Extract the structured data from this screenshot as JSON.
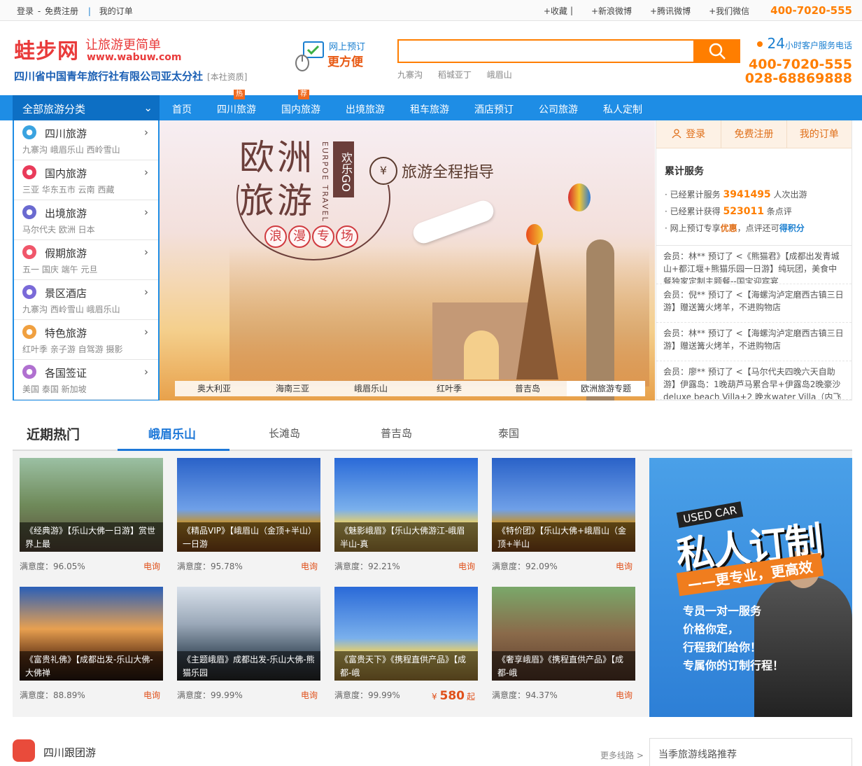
{
  "topbar": {
    "login": "登录",
    "sep": "-",
    "register": "免费注册",
    "divider": "|",
    "orders": "我的订单",
    "links": [
      "+收藏",
      "|",
      "+新浪微博",
      "+腾讯微博",
      "+我们微信"
    ],
    "phone": "400-7020-555"
  },
  "header": {
    "brand": "蛙步网",
    "slogan": "让旅游更简单",
    "url": "www.wabuw.com",
    "company": "四川省中国青年旅行社有限公司亚太分社",
    "company_tag": "[本社资质]",
    "online_line1": "网上预订",
    "online_line2": "更方便",
    "search_placeholder": "",
    "hotwords": [
      "九寨沟",
      "稻城亚丁",
      "峨眉山"
    ],
    "service_24": "24",
    "service_label": "小时客户服务电话",
    "phone1": "400-7020-555",
    "phone2": "028-68869888"
  },
  "nav": {
    "allcat": "全部旅游分类",
    "items": [
      {
        "label": "首页",
        "tag": ""
      },
      {
        "label": "四川旅游",
        "tag": "热"
      },
      {
        "label": "国内旅游",
        "tag": "荐"
      },
      {
        "label": "出境旅游",
        "tag": ""
      },
      {
        "label": "租车旅游",
        "tag": ""
      },
      {
        "label": "酒店预订",
        "tag": ""
      },
      {
        "label": "公司旅游",
        "tag": ""
      },
      {
        "label": "私人定制",
        "tag": ""
      }
    ]
  },
  "categories": [
    {
      "name": "四川旅游",
      "sub": "九寨沟  峨眉乐山  西岭雪山",
      "icon": "panda-icon",
      "color": "#3aa3e0"
    },
    {
      "name": "国内旅游",
      "sub": "三亚 华东五市 云南 西藏",
      "icon": "china-map-icon",
      "color": "#e93b5a"
    },
    {
      "name": "出境旅游",
      "sub": "马尔代夫 欧洲 日本",
      "icon": "globe-flower-icon",
      "color": "#6a6ad0"
    },
    {
      "name": "假期旅游",
      "sub": "五一  国庆  端午  元旦",
      "icon": "camera-icon",
      "color": "#f0566a"
    },
    {
      "name": "景区酒店",
      "sub": "九寨沟  西岭雪山  峨眉乐山",
      "icon": "hotel-icon",
      "color": "#7a6ad8"
    },
    {
      "name": "特色旅游",
      "sub": "红叶季  亲子游  自驾游  摄影",
      "icon": "tag-icon",
      "color": "#f0a040"
    },
    {
      "name": "各国签证",
      "sub": "美国 泰国 新加坡",
      "icon": "balloon-icon",
      "color": "#b070d0"
    }
  ],
  "banner": {
    "title_line1": "欧洲",
    "title_line2": "旅游",
    "vertical": "欢乐GO",
    "english": "EURPOE TRAVEL",
    "roman": [
      "浪",
      "漫",
      "专",
      "场"
    ],
    "guide_icon": "¥",
    "guide": "旅游全程指导",
    "tabs": [
      "奥大利亚",
      "海南三亚",
      "峨眉乐山",
      "红叶季",
      "普吉岛",
      "欧洲旅游专题"
    ]
  },
  "side": {
    "login": "登录",
    "register": "免费注册",
    "orders": "我的订单",
    "heading": "累计服务",
    "stat1_pre": "已经累计服务",
    "stat1_num": "3941495",
    "stat1_post": "人次出游",
    "stat2_pre": "已经累计获得",
    "stat2_num": "523011",
    "stat2_post": "条点评",
    "stat3_pre": "网上预订专享",
    "stat3_hl": "优惠",
    "stat3_mid": "，点评还可",
    "stat3_hl2": "得积分",
    "feeds": [
      "会员：林** 预订了 <《熊猫君》【成都出发青城山+都江堰+熊猫乐园一日游】纯玩团，美食中餐独家定制主题餐--国宝迎宾宴",
      "会员：倪** 预订了 <【海螺沟泸定磨西古镇三日游】赠送篝火烤羊，不进购物店",
      "会员：林** 预订了 <【海螺沟泸定磨西古镇三日游】赠送篝火烤羊，不进购物店",
      "会员：廖** 预订了 <【马尔代夫四晚六天自助游】伊露岛：1晚葫芦马累合早+伊露岛2晚豪沙deluxe beach Villa+2 晚水water Villa（内飞接"
    ]
  },
  "hot": {
    "title": "近期热门",
    "tabs": [
      "峨眉乐山",
      "长滩岛",
      "普吉岛",
      "泰国"
    ],
    "cards": [
      {
        "caption": "《经典游》【乐山大佛一日游】赏世界上最",
        "rating": "满意度：96.05%",
        "action": "电询",
        "price": ""
      },
      {
        "caption": "《精品VIP》【峨眉山（金顶+半山）一日游",
        "rating": "满意度：95.78%",
        "action": "电询",
        "price": ""
      },
      {
        "caption": "《魅影峨眉》【乐山大佛游江-峨眉半山-真",
        "rating": "满意度：92.21%",
        "action": "电询",
        "price": ""
      },
      {
        "caption": "《特价团》【乐山大佛+峨眉山（金顶+半山",
        "rating": "满意度：92.09%",
        "action": "电询",
        "price": ""
      },
      {
        "caption": "《富贵礼佛》【成都出发-乐山大佛-大佛禅",
        "rating": "满意度：88.89%",
        "action": "电询",
        "price": ""
      },
      {
        "caption": "《主题峨眉》成都出发-乐山大佛-熊猫乐园",
        "rating": "满意度：99.99%",
        "action": "电询",
        "price": ""
      },
      {
        "caption": "《富贵天下》《携程直供产品》【成都-峨",
        "rating": "满意度：99.99%",
        "action": "起",
        "price": "580"
      },
      {
        "caption": "《奢享峨眉》《携程直供产品》【成都-峨",
        "rating": "满意度：94.37%",
        "action": "电询",
        "price": ""
      }
    ]
  },
  "ad": {
    "usedcar": "USED CAR",
    "big": "私人订制",
    "ribbon": "——更专业，更高效",
    "lines": [
      "专员一对一服务",
      "价格你定，",
      "行程我们给你！",
      "专属你的订制行程！"
    ]
  },
  "bottom": {
    "title": "四川跟团游",
    "more": "更多线路 >",
    "right": "当季旅游线路推荐"
  }
}
